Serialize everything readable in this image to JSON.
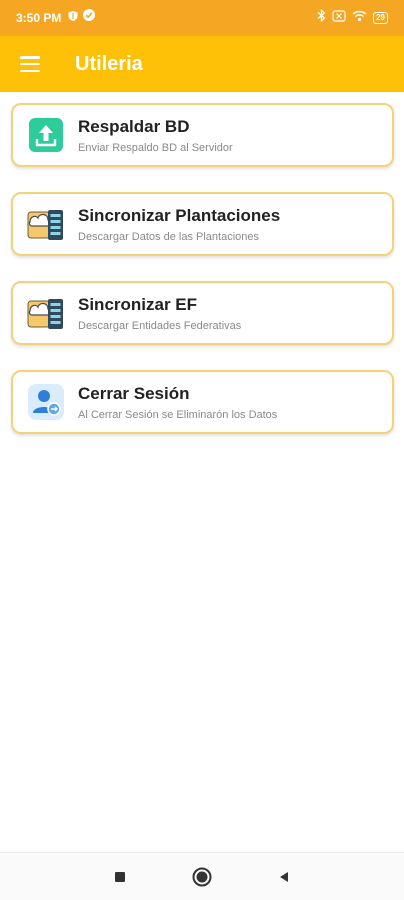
{
  "status_bar": {
    "time": "3:50 PM",
    "battery": "29",
    "icons": [
      "shield-icon",
      "check-circle-icon",
      "bluetooth-icon",
      "sim-off-icon",
      "wifi-icon",
      "battery-icon"
    ]
  },
  "app_bar": {
    "title": "Utileria",
    "menu_icon": "hamburger-menu-icon",
    "background": "#FFC107"
  },
  "menu_items": [
    {
      "title": "Respaldar BD",
      "subtitle": "Enviar Respaldo BD al Servidor",
      "icon": "upload-icon"
    },
    {
      "title": "Sincronizar Plantaciones",
      "subtitle": "Descargar Datos de las Plantaciones",
      "icon": "cloud-sync-icon"
    },
    {
      "title": "Sincronizar EF",
      "subtitle": "Descargar Entidades Federativas",
      "icon": "cloud-sync-icon"
    },
    {
      "title": "Cerrar Sesión",
      "subtitle": "Al Cerrar Sesión se Eliminarón los Datos",
      "icon": "user-logout-icon"
    }
  ],
  "nav_bar": {
    "icons": [
      "recent-apps-icon",
      "home-icon",
      "back-icon"
    ]
  },
  "colors": {
    "status_bar": "#F5A623",
    "card_border": "#F5D27A",
    "upload_icon": "#2ECC9A"
  }
}
